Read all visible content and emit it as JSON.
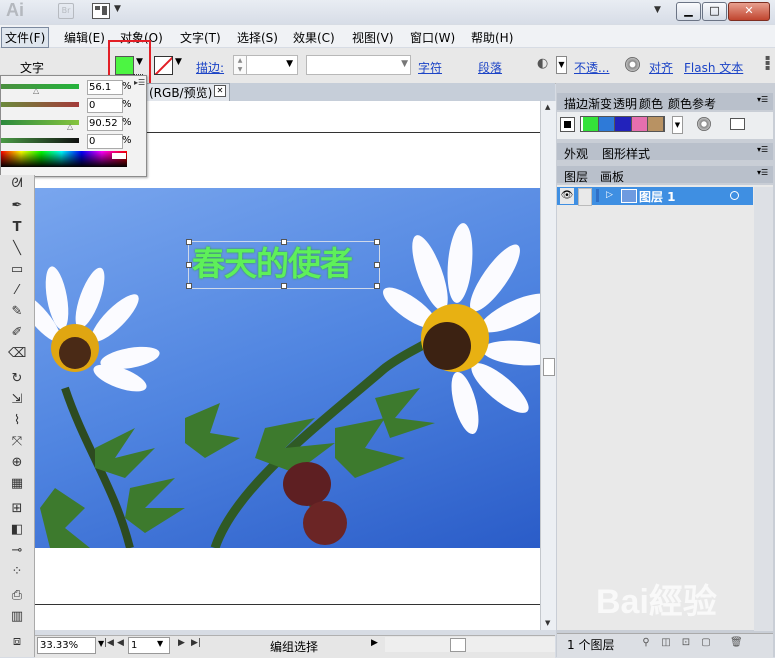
{
  "app": {
    "logo": "Ai",
    "bridge_label": "Br"
  },
  "menus": [
    "文件(F)",
    "编辑(E)",
    "对象(O)",
    "文字(T)",
    "选择(S)",
    "效果(C)",
    "视图(V)",
    "窗口(W)",
    "帮助(H)"
  ],
  "control_bar": {
    "label": "文字",
    "stroke_label": "描边:",
    "character_link": "字符",
    "paragraph_link": "段落",
    "opacity_link": "不透...",
    "align_link": "对齐",
    "flash_link": "Flash 文本"
  },
  "document_tab": {
    "title": "(RGB/预览)"
  },
  "color_panel": {
    "values": [
      "56.1",
      "0",
      "90.52",
      "0"
    ],
    "unit": "%",
    "fill_color": "#4cf542"
  },
  "canvas": {
    "headline": "春天的使者"
  },
  "status_bar": {
    "zoom": "33.33%",
    "page": "1",
    "status": "编组选择"
  },
  "right_panel": {
    "top_tabs": [
      "描边",
      "渐变",
      "透明",
      "颜色",
      "颜色参考"
    ],
    "mid_tabs": [
      "外观",
      "图形样式"
    ],
    "layer_tabs": [
      "图层",
      "画板"
    ],
    "color_group": [
      "#34e23a",
      "#2e7ad8",
      "#2222bb",
      "#e56fae",
      "#b89263"
    ],
    "layer_name": "图层 1",
    "layer_count": "1 个图层"
  },
  "colors": {
    "highlight_box": "#e21f26",
    "selection_blue": "#3f8fe2"
  }
}
